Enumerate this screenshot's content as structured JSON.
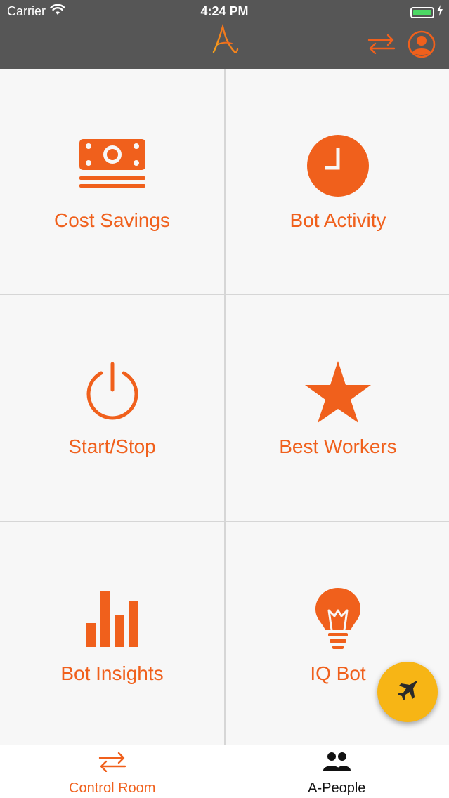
{
  "status_bar": {
    "carrier": "Carrier",
    "time": "4:24 PM",
    "icons": [
      "wifi-icon",
      "battery-icon",
      "charging-bolt-icon"
    ]
  },
  "header": {
    "logo_icon": "a-logo-icon",
    "swap_icon": "swap-arrows-icon",
    "profile_icon": "profile-avatar-icon"
  },
  "tiles": [
    {
      "label": "Cost Savings",
      "icon": "money-icon"
    },
    {
      "label": "Bot Activity",
      "icon": "clock-icon"
    },
    {
      "label": "Start/Stop",
      "icon": "power-icon"
    },
    {
      "label": "Best Workers",
      "icon": "star-icon"
    },
    {
      "label": "Bot Insights",
      "icon": "bar-chart-icon"
    },
    {
      "label": "IQ Bot",
      "icon": "lightbulb-icon"
    }
  ],
  "fab": {
    "icon": "jet-plane-icon"
  },
  "tabbar": {
    "tabs": [
      {
        "label": "Control Room",
        "icon": "swap-arrows-icon",
        "active": true
      },
      {
        "label": "A-People",
        "icon": "people-icon",
        "active": false
      }
    ]
  },
  "colors": {
    "accent": "#f0601c",
    "header_bg": "#565656",
    "fab_bg": "#f7b515",
    "tile_bg": "#f7f7f7",
    "grid_lines": "#d6d6d6",
    "battery_green": "#4cd964"
  }
}
